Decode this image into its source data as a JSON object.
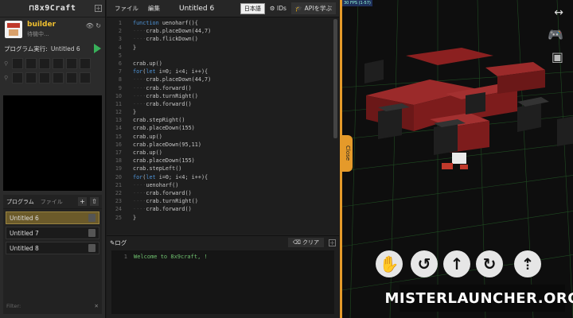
{
  "left": {
    "logo": "⊓8x9Craft",
    "builder": {
      "name": "builder",
      "status": "待機中..."
    },
    "program_run": {
      "label": "プログラム実行:",
      "current": "Untitled 6"
    },
    "program_panel": {
      "tab_program": "プログラム",
      "tab_file": "ファイル",
      "items": [
        {
          "label": "Untitled 6",
          "selected": true
        },
        {
          "label": "Untitled 7",
          "selected": false
        },
        {
          "label": "Untitled 8",
          "selected": false
        }
      ],
      "filter_placeholder": "Filter:"
    }
  },
  "editor": {
    "menu": {
      "file": "ファイル",
      "edit": "編集"
    },
    "title": "Untitled 6",
    "language": "日本語",
    "ids_label": "IDs",
    "learn_label": "APIを学ぶ",
    "line_numbers": [
      "1",
      "2",
      "3",
      "4",
      "5",
      "6",
      "7",
      "8",
      "9",
      "10",
      "11",
      "12",
      "13",
      "14",
      "15",
      "16",
      "17",
      "18",
      "19",
      "20",
      "21",
      "22",
      "23",
      "24",
      "25"
    ],
    "code_lines": [
      "function uenoharf(){",
      "····crab.placeDown(44,7)",
      "····crab.flickDown()",
      "}",
      "",
      "crab.up()",
      "for(let i=0; i<4; i++){",
      "····crab.placeDown(44,7)",
      "····crab.forward()",
      "····crab.turnRight()",
      "····crab.forward()",
      "}",
      "crab.stepRight()",
      "crab.placeDown(155)",
      "crab.up()",
      "crab.placeDown(95,11)",
      "crab.up()",
      "crab.placeDown(155)",
      "crab.stepLeft()",
      "for(let i=0; i<4; i++){",
      "····uenoharf()",
      "····crab.forward()",
      "····crab.turnRight()",
      "····crab.forward()",
      "}"
    ],
    "log": {
      "title": "ログ",
      "clear": "クリア",
      "lines": [
        {
          "n": "1",
          "text": "Welcome to 8x9craft, !"
        }
      ]
    }
  },
  "view": {
    "fps": "30 FPS (1-57)",
    "close": "Close",
    "watermark": "MISTERLAUNCHER.ORG"
  }
}
